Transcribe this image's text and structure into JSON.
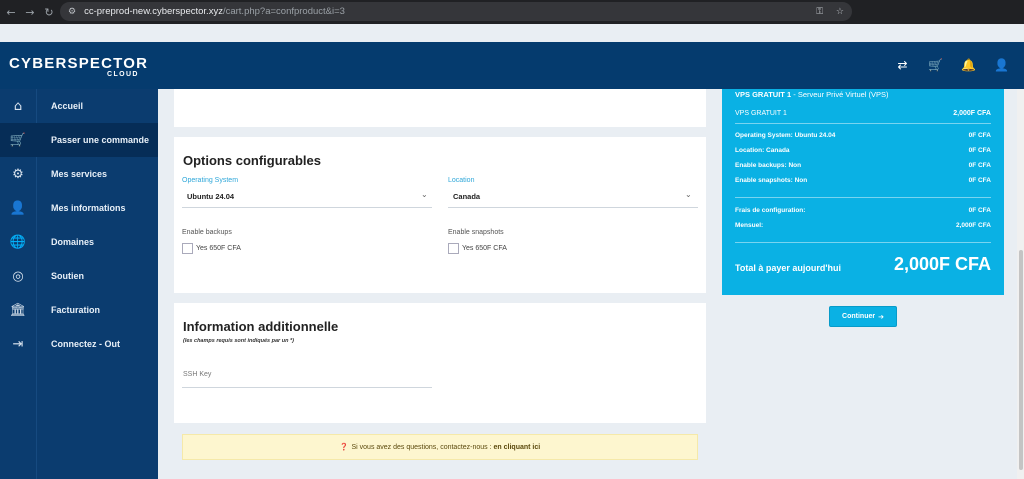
{
  "browser": {
    "url_host": "cc-preprod-new.cyberspector.xyz",
    "url_path": "/cart.php?a=confproduct&i=3",
    "back_icon": "arrow-left-icon",
    "forward_icon": "arrow-right-icon",
    "reload_icon": "reload-icon"
  },
  "header": {
    "logo_text": "CYBERSPECTOR",
    "logo_sub": "CLOUD",
    "icons": [
      "translate-icon",
      "cart-icon",
      "bell-icon",
      "user-icon"
    ]
  },
  "sidebar": {
    "items": [
      {
        "label": "Accueil",
        "icon": "home-icon",
        "glyph": "⌂"
      },
      {
        "label": "Passer une commande",
        "icon": "cart-icon",
        "glyph": "🛒"
      },
      {
        "label": "Mes services",
        "icon": "gears-icon",
        "glyph": "⚙"
      },
      {
        "label": "Mes informations",
        "icon": "user-icon",
        "glyph": "👤"
      },
      {
        "label": "Domaines",
        "icon": "globe-icon",
        "glyph": "🌐"
      },
      {
        "label": "Soutien",
        "icon": "lifebuoy-icon",
        "glyph": "◎"
      },
      {
        "label": "Facturation",
        "icon": "bank-icon",
        "glyph": "🏛"
      },
      {
        "label": "Connectez - Out",
        "icon": "sign-out-icon",
        "glyph": "⇥"
      }
    ]
  },
  "options": {
    "title": "Options configurables",
    "os_label": "Operating System",
    "os_value": "Ubuntu 24.04",
    "location_label": "Location",
    "location_value": "Canada",
    "backups_label": "Enable backups",
    "backups_option": "Yes 650F CFA",
    "snapshots_label": "Enable snapshots",
    "snapshots_option": "Yes 650F CFA"
  },
  "additional": {
    "title": "Information additionnelle",
    "note": "(les champs requis sont indiqués par un *)",
    "ssh_placeholder": "SSH Key"
  },
  "alert": {
    "text": "Si vous avez des questions, contactez-nous :",
    "link": "en cliquant ici"
  },
  "summary": {
    "product_name": "VPS GRATUIT 1",
    "product_sep": "-",
    "product_group": "Serveur Privé Virtuel (VPS)",
    "line_name": "VPS GRATUIT 1",
    "line_price": "2,000F CFA",
    "items": [
      {
        "label": "Operating System: Ubuntu 24.04",
        "price": "0F CFA"
      },
      {
        "label": "Location: Canada",
        "price": "0F CFA"
      },
      {
        "label": "Enable backups: Non",
        "price": "0F CFA"
      },
      {
        "label": "Enable snapshots: Non",
        "price": "0F CFA"
      }
    ],
    "setup_label": "Frais de configuration:",
    "setup_price": "0F CFA",
    "monthly_label": "Mensuel:",
    "monthly_price": "2,000F CFA",
    "total_label": "Total à payer aujourd'hui",
    "total_value": "2,000F CFA"
  },
  "continue_label": "Continuer"
}
